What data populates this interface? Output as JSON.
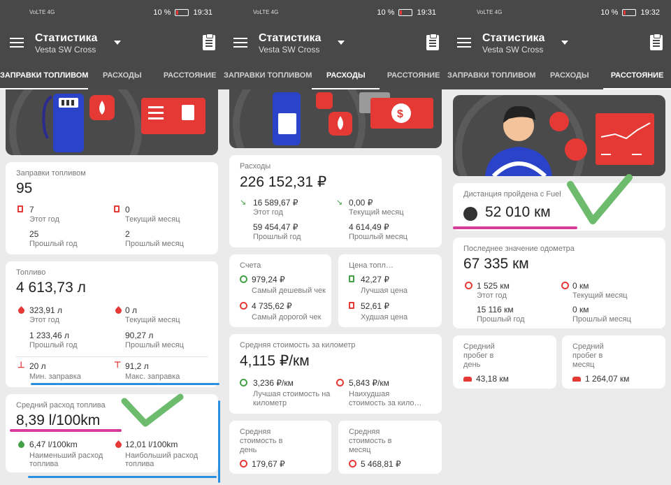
{
  "status": {
    "screens": [
      {
        "net": "VoLTE 4G",
        "battery": "10 %",
        "time": "19:31"
      },
      {
        "net": "VoLTE 4G",
        "battery": "10 %",
        "time": "19:31"
      },
      {
        "net": "VoLTE 4G",
        "battery": "10 %",
        "time": "19:32"
      }
    ]
  },
  "app": {
    "title": "Статистика",
    "subtitle": "Vesta SW Cross"
  },
  "tabs": [
    "ЗАПРАВКИ ТОПЛИВОМ",
    "РАСХОДЫ",
    "РАССТОЯНИЕ"
  ],
  "fuel": {
    "refuels": {
      "label": "Заправки топливом",
      "value": "95",
      "year": "7",
      "year_label": "Этот год",
      "month": "0",
      "month_label": "Текущий месяц",
      "prev_year": "25",
      "prev_year_label": "Прошлый год",
      "prev_month": "2",
      "prev_month_label": "Прошлый месяц"
    },
    "liters": {
      "label": "Топливо",
      "value": "4 613,73 л",
      "year": "323,91 л",
      "year_label": "Этот год",
      "month": "0 л",
      "month_label": "Текущий месяц",
      "prev_year": "1 233,46 л",
      "prev_year_label": "Прошлый год",
      "prev_month": "90,27 л",
      "prev_month_label": "Прошлый месяц",
      "min": "20 л",
      "min_label": "Мин. заправка",
      "max": "91,2 л",
      "max_label": "Макс. заправка"
    },
    "avg": {
      "label": "Средний расход топлива",
      "value": "8,39 l/100km",
      "min": "6,47 l/100km",
      "min_label": "Наименьший расход топлива",
      "max": "12,01 l/100km",
      "max_label": "Наибольший расход топлива"
    }
  },
  "costs": {
    "total": {
      "label": "Расходы",
      "value": "226 152,31 ₽",
      "year": "16 589,67 ₽",
      "year_label": "Этот год",
      "month": "0,00 ₽",
      "month_label": "Текущий месяц",
      "prev_year": "59 454,47 ₽",
      "prev_year_label": "Прошлый год",
      "prev_month": "4 614,49 ₽",
      "prev_month_label": "Прошлый месяц"
    },
    "bills": {
      "label": "Счета",
      "cheap": "979,24 ₽",
      "cheap_label": "Самый дешевый чек",
      "dear": "4 735,62 ₽",
      "dear_label": "Самый дорогой чек"
    },
    "price": {
      "label": "Цена топл…",
      "best": "42,27 ₽",
      "best_label": "Лучшая цена",
      "worst": "52,61 ₽",
      "worst_label": "Худшая цена"
    },
    "per_km": {
      "label": "Средняя стоимость за километр",
      "value": "4,115 ₽/км",
      "best": "3,236 ₽/км",
      "best_label1": "Лучшая стоимость на",
      "best_label2": "километр",
      "worst": "5,843 ₽/км",
      "worst_label1": "Наихудшая",
      "worst_label2": "стоимость за кило…"
    },
    "per_day": {
      "label1": "Средняя",
      "label2": "стоимость в",
      "label3": "день",
      "value": "179,67 ₽"
    },
    "per_month": {
      "label1": "Средняя",
      "label2": "стоимость в",
      "label3": "месяц",
      "value": "5 468,81 ₽"
    }
  },
  "distance": {
    "total": {
      "label": "Дистанция пройдена с Fuel",
      "value": "52 010 км"
    },
    "odo": {
      "label": "Последнее значение одометра",
      "value": "67 335 км",
      "year": "1 525 км",
      "year_label": "Этот год",
      "month": "0 км",
      "month_label": "Текущий месяц",
      "prev_year": "15 116 км",
      "prev_year_label": "Прошлый год",
      "prev_month": "0 км",
      "prev_month_label": "Прошлый месяц"
    },
    "per_day": {
      "label1": "Средний",
      "label2": "пробег в",
      "label3": "день",
      "value": "43,18 км"
    },
    "per_month": {
      "label1": "Средний",
      "label2": "пробег в",
      "label3": "месяц",
      "value": "1 264,07 км"
    }
  },
  "colors": {
    "bar": "#484848",
    "accent": "#e53935",
    "good": "#43a047",
    "annot_blue": "#2a8fe0",
    "annot_pink": "#d63c9a",
    "annot_check": "#6dbb6d"
  }
}
